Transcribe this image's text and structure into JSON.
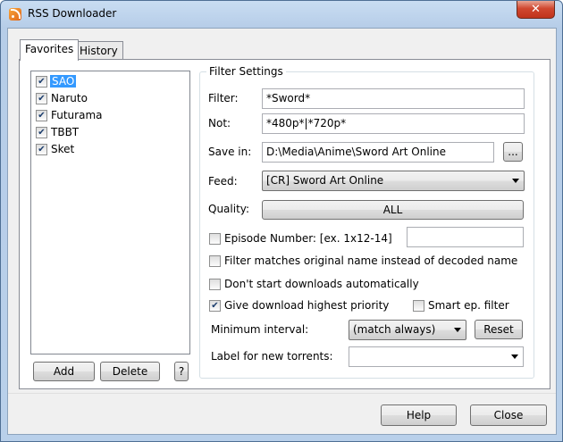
{
  "window": {
    "title": "RSS Downloader",
    "close_glyph": "✕"
  },
  "tabs": [
    {
      "label": "Favorites",
      "active": true
    },
    {
      "label": "History",
      "active": false
    }
  ],
  "favorites": [
    {
      "label": "SAO",
      "checked": true,
      "selected": true
    },
    {
      "label": "Naruto",
      "checked": true,
      "selected": false
    },
    {
      "label": "Futurama",
      "checked": true,
      "selected": false
    },
    {
      "label": "TBBT",
      "checked": true,
      "selected": false
    },
    {
      "label": "Sket",
      "checked": true,
      "selected": false
    }
  ],
  "list_buttons": {
    "add": "Add",
    "delete": "Delete",
    "help": "?"
  },
  "filter": {
    "group_title": "Filter Settings",
    "filter_label": "Filter:",
    "filter_value": "*Sword*",
    "not_label": "Not:",
    "not_value": "*480p*|*720p*",
    "save_in_label": "Save in:",
    "save_in_value": "D:\\Media\\Anime\\Sword Art Online",
    "browse_button": "...",
    "feed_label": "Feed:",
    "feed_value": "[CR] Sword Art Online",
    "quality_label": "Quality:",
    "quality_value": "ALL",
    "episode_label": "Episode Number: [ex. 1x12-14]",
    "episode_checked": false,
    "episode_value": "",
    "match_original_label": "Filter matches original name instead of decoded name",
    "match_original_checked": false,
    "no_auto_start_label": "Don't start downloads automatically",
    "no_auto_start_checked": false,
    "high_priority_label": "Give download highest priority",
    "high_priority_checked": true,
    "smart_ep_label": "Smart ep. filter",
    "smart_ep_checked": false,
    "min_interval_label": "Minimum interval:",
    "min_interval_value": "(match always)",
    "reset_button": "Reset",
    "label_label": "Label for new torrents:",
    "label_value": ""
  },
  "footer": {
    "help": "Help",
    "close": "Close"
  }
}
